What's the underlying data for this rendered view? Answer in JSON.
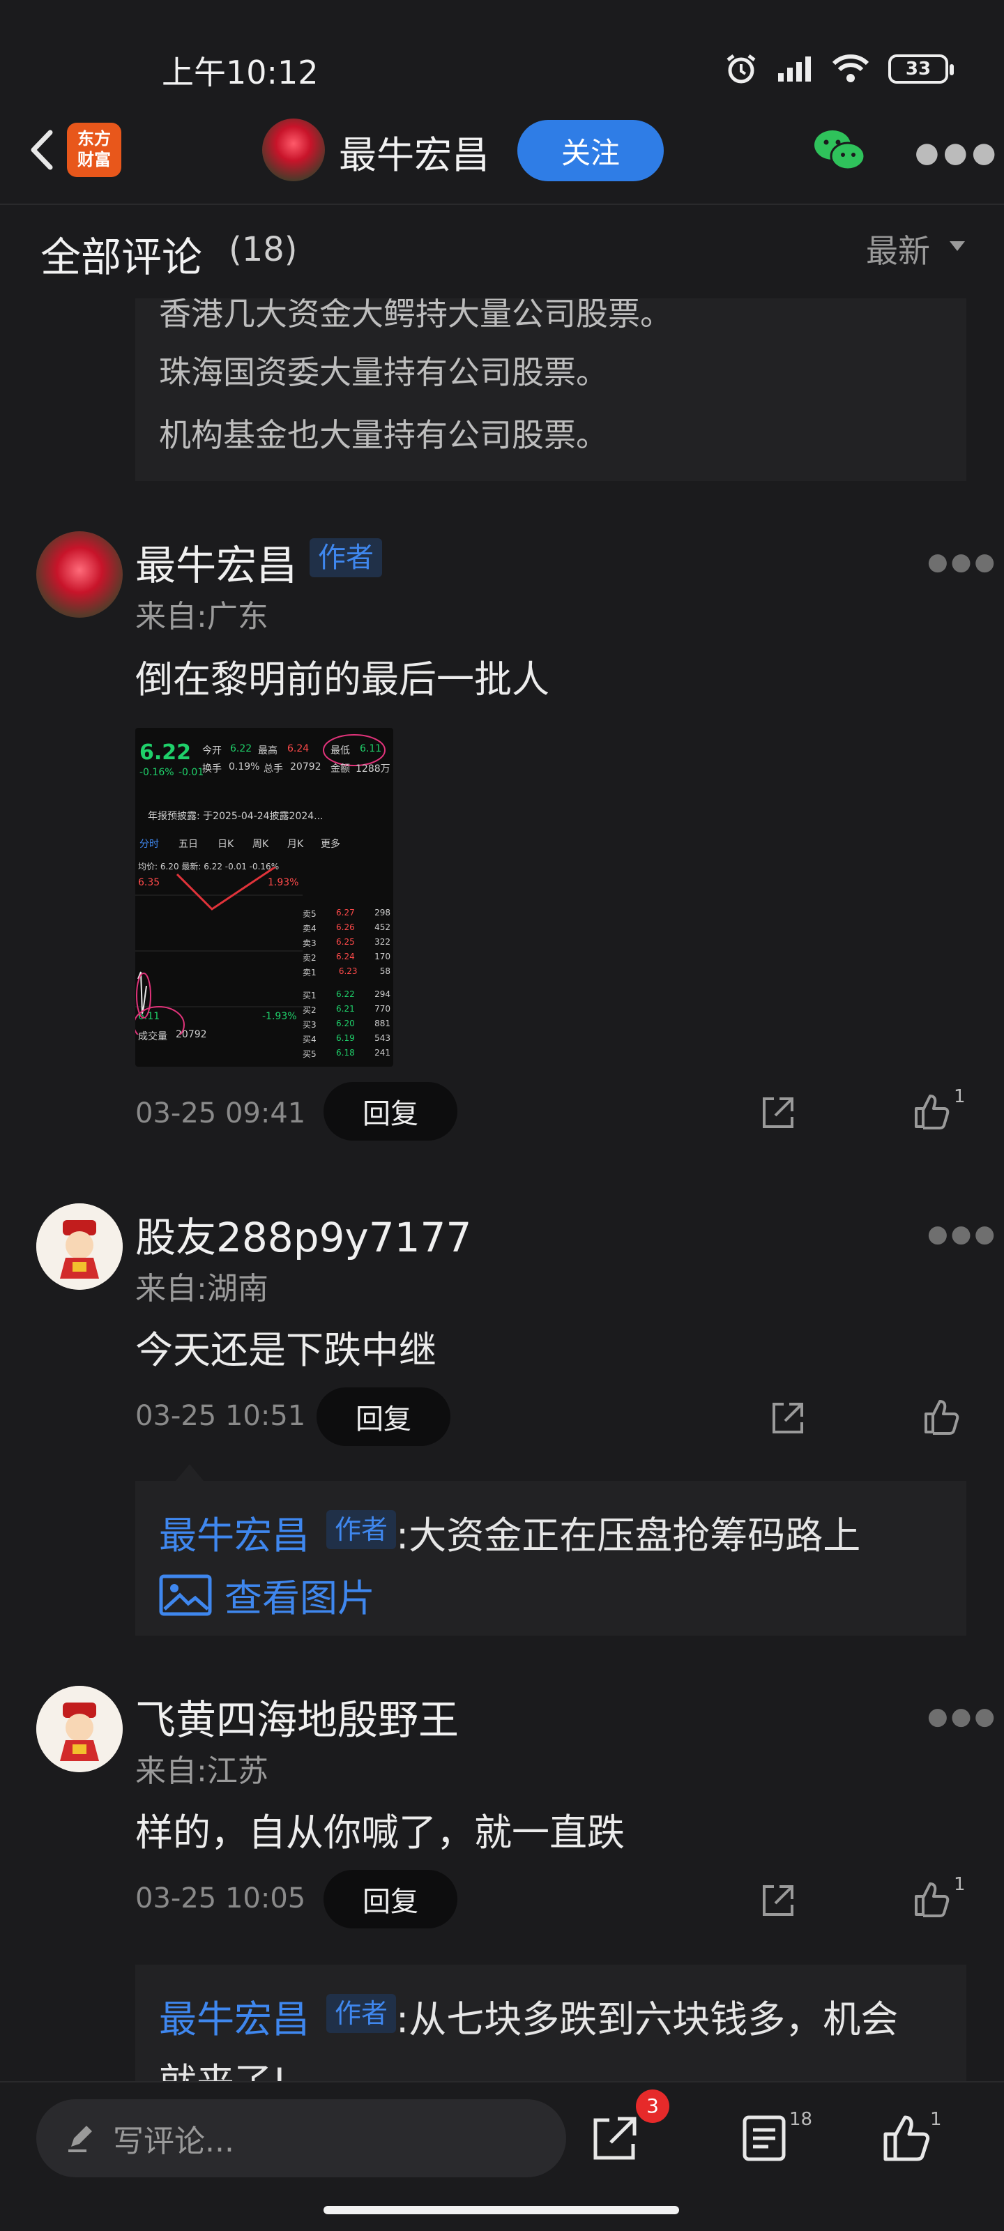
{
  "status_bar": {
    "time": "上午10:12",
    "battery": "33"
  },
  "header": {
    "brand": "东方财富",
    "brand_line1": "东方",
    "brand_line2": "财富",
    "username": "最牛宏昌",
    "follow_label": "关注"
  },
  "comments_header": {
    "title": "全部评论",
    "count": "(18)",
    "sort_label": "最新"
  },
  "quote_lines": [
    "香港几大资金大鳄持大量公司股票。",
    "珠海国资委大量持有公司股票。",
    "机构基金也大量持有公司股票。"
  ],
  "comments": [
    {
      "name": "最牛宏昌",
      "author_tag": "作者",
      "location": "来自:广东",
      "text": "倒在黎明前的最后一批人",
      "time": "03-25 09:41",
      "reply_label": "回复",
      "like_count": "1",
      "image": {
        "price": "6.22",
        "change": "-0.16%",
        "change_abs": "-0.01",
        "open_label": "今开",
        "open": "6.22",
        "high_label": "最高",
        "high": "6.24",
        "low_label": "最低",
        "low": "6.11",
        "turnover_label": "换手",
        "turnover": "0.19%",
        "vol_label": "总手",
        "vol": "20792",
        "amount_label": "金额",
        "amount": "1288万",
        "notice": "年报预披露: 于2025-04-24披露2024...",
        "tabs": [
          "分时",
          "五日",
          "日K",
          "周K",
          "月K",
          "更多"
        ],
        "avg_line": "均价: 6.20  最新: 6.22  -0.01  -0.16%",
        "order_book": [
          {
            "label": "卖5",
            "price": "6.27",
            "vol": "298"
          },
          {
            "label": "卖4",
            "price": "6.26",
            "vol": "452"
          },
          {
            "label": "卖3",
            "price": "6.25",
            "vol": "322"
          },
          {
            "label": "卖2",
            "price": "6.24",
            "vol": "170"
          },
          {
            "label": "卖1",
            "price": "6.23",
            "vol": "58"
          },
          {
            "label": "买1",
            "price": "6.22",
            "vol": "294"
          },
          {
            "label": "买2",
            "price": "6.21",
            "vol": "770"
          },
          {
            "label": "买3",
            "price": "6.20",
            "vol": "881"
          },
          {
            "label": "买4",
            "price": "6.19",
            "vol": "543"
          },
          {
            "label": "买5",
            "price": "6.18",
            "vol": "241"
          }
        ],
        "axis_high": "6.35",
        "axis_low": "6.11",
        "pct_high": "1.93%",
        "pct_low": "-1.93%",
        "vol_label2": "成交量",
        "vol_value": "20792"
      }
    },
    {
      "name": "股友288p9y7177",
      "location": "来自:湖南",
      "text": "今天还是下跌中继",
      "time": "03-25 10:51",
      "reply_label": "回复",
      "sub_reply": {
        "name": "最牛宏昌",
        "tag": "作者",
        "text": ":大资金正在压盘抢筹码路上",
        "view_image": "查看图片"
      }
    },
    {
      "name": "飞黄四海地殷野王",
      "location": "来自:江苏",
      "text": "样的，自从你喊了，就一直跌",
      "time": "03-25 10:05",
      "reply_label": "回复",
      "like_count": "1",
      "sub_reply": {
        "name": "最牛宏昌",
        "tag": "作者",
        "text": ":从七块多跌到六块钱多，机会",
        "text2": "就来了!"
      }
    }
  ],
  "bottom_bar": {
    "write_placeholder": "写评论...",
    "share_badge": "3",
    "comment_count": "18",
    "like_count": "1"
  }
}
